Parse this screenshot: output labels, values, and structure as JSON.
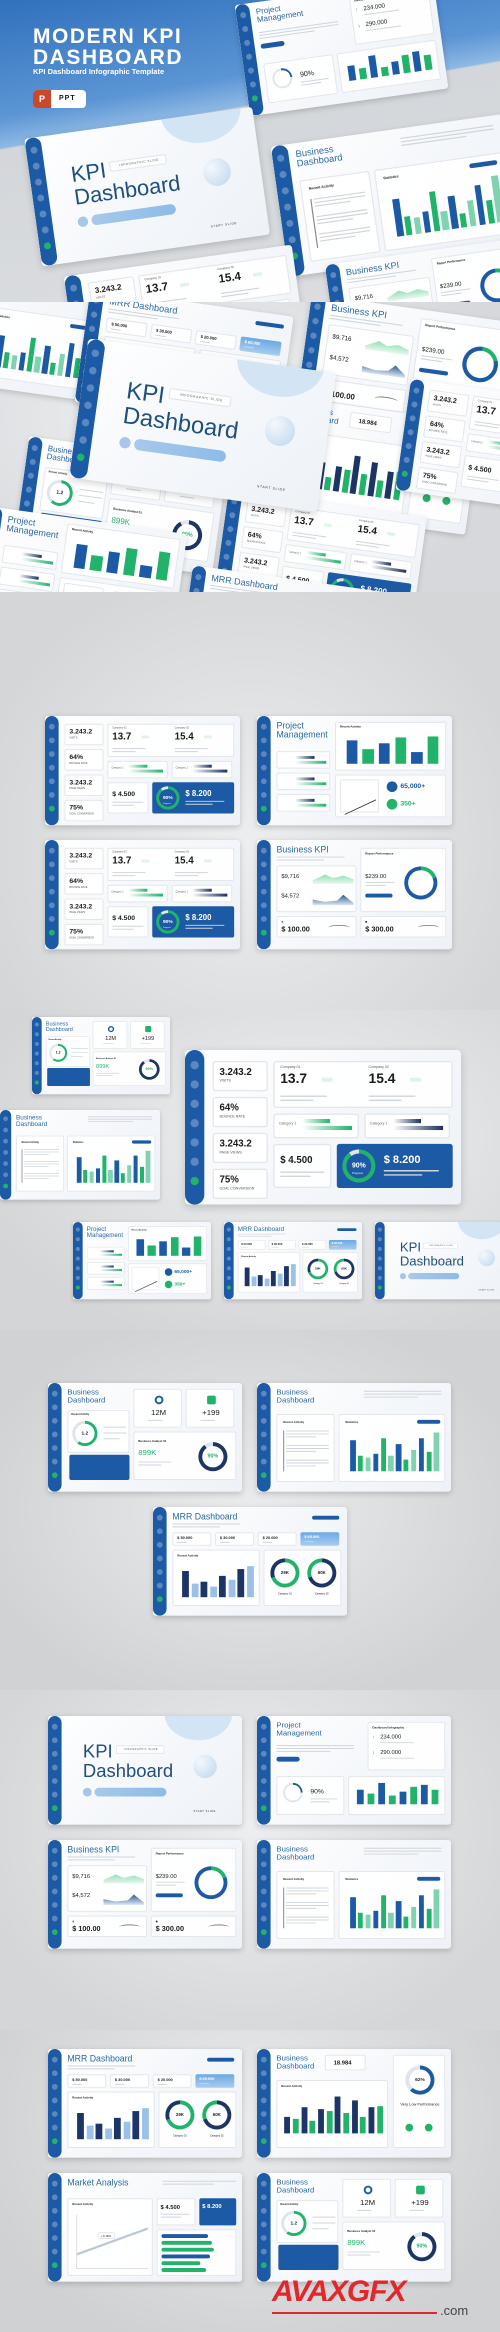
{
  "hero": {
    "title_line1": "MODERN KPI",
    "title_line2": "DASHBOARD",
    "subtitle": "KPI Dashboard Infographic Template",
    "format_badge": "PPT",
    "format_icon": "powerpoint-icon"
  },
  "colors": {
    "primary_blue": "#1c5aa6",
    "accent_green": "#22b36b",
    "title_blue": "#2a68a8",
    "background_gray": "#d6d7d9"
  },
  "slide_templates": {
    "kpi_stats": {
      "stats": [
        {
          "value": "3.243.2",
          "label": "VISITS"
        },
        {
          "value": "64%",
          "label": "BOUNCE RATE"
        },
        {
          "value": "3.243.2",
          "label": "PAGE VIEWS"
        },
        {
          "value": "75%",
          "label": "GOAL CONVERSION"
        }
      ],
      "companies": [
        {
          "label": "Company 01",
          "value": "13.7"
        },
        {
          "label": "Company 02",
          "value": "15.4"
        }
      ],
      "categories": [
        "Category 1",
        "Category 1"
      ],
      "money": "$ 4.500",
      "progress": {
        "value": "90%",
        "label": "Progress",
        "fraction": 0.9
      },
      "highlight": "$ 8.200"
    },
    "project": {
      "title": "Project Management",
      "chart_title": "Recent Activity",
      "counters": [
        "65,000+",
        "350+"
      ]
    },
    "business_kpi": {
      "title": "Business KPI",
      "values": [
        "$9,716",
        "$4,572"
      ],
      "report_title": "Report Performance",
      "report_value": "$239.00",
      "money": [
        "$ 100.00",
        "$ 300.00"
      ]
    },
    "business_summary": {
      "title": "Business Dashboard",
      "activity_title": "Recent Activity",
      "gauge_value": "1.2",
      "counters": [
        "12M",
        "+199"
      ],
      "analyst_title": "Business Analyst 01",
      "analyst_value": "899K",
      "progress": {
        "value": "90%",
        "fraction": 0.9
      }
    },
    "business_statistics": {
      "title": "Business Dashboard",
      "activity_title": "Recent Activity",
      "statistics_title": "Statistics"
    },
    "mrr": {
      "title": "MRR Dashboard",
      "activity_title": "Recent Activity",
      "values": [
        "$ 50.000",
        "$ 30.000",
        "$ 20.000",
        "$ 65.000"
      ],
      "rings": [
        {
          "value": "29K",
          "label": "Category 01"
        },
        {
          "value": "60K",
          "label": "Category 02"
        }
      ]
    },
    "title_slide": {
      "title_line1": "KPI",
      "title_line2": "Dashboard",
      "tag": "INFOGRAPHIC SLIDE",
      "start": "START SLIDE"
    },
    "project_infographic": {
      "title": "Project Management",
      "card_title": "Dashboard Infographic",
      "up_value": "234.000",
      "down_value": "290.000",
      "percent": "90%"
    },
    "business_monthly": {
      "title": "Business Dashboard",
      "counter": "18.984",
      "activity_title": "Recent Activity",
      "gauge": "62%",
      "gauge_fraction": 0.62,
      "performance": "Very Low Performance"
    },
    "market": {
      "title": "Market Analysis",
      "activity_title": "Recent Activity",
      "change": "+ 0.18%",
      "money": "$ 4.500",
      "highlight": "$ 8.200"
    }
  },
  "watermark": {
    "brand": "AVAXGFX",
    "domain": ".com"
  }
}
